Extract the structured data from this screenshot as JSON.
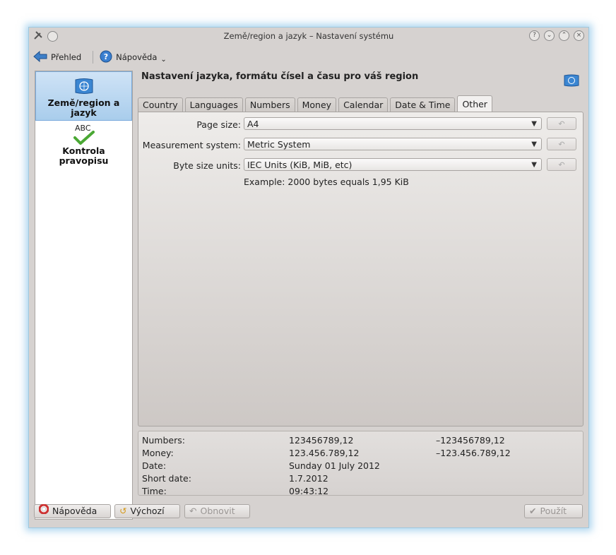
{
  "window": {
    "title": "Země/region a jazyk – Nastavení systému"
  },
  "toolbar": {
    "overview_label": "Přehled",
    "help_label": "Nápověda"
  },
  "sidebar": {
    "items": [
      {
        "label_line1": "Země/region a",
        "label_line2": "jazyk"
      },
      {
        "label_line1": "Kontrola",
        "label_line2": "pravopisu",
        "icon_text": "ABC"
      }
    ]
  },
  "content": {
    "title": "Nastavení jazyka, formátu čísel a času pro váš region"
  },
  "tabs": [
    "Country",
    "Languages",
    "Numbers",
    "Money",
    "Calendar",
    "Date & Time",
    "Other"
  ],
  "active_tab": "Other",
  "settings": {
    "page_size": {
      "label": "Page size:",
      "value": "A4"
    },
    "measurement": {
      "label": "Measurement system:",
      "value": "Metric System"
    },
    "byte_units": {
      "label": "Byte size units:",
      "value": "IEC Units (KiB, MiB, etc)"
    },
    "example": "Example: 2000 bytes equals 1,95 KiB"
  },
  "preview": {
    "rows": [
      {
        "label": "Numbers:",
        "v1": "123456789,12",
        "v2": "–123456789,12"
      },
      {
        "label": "Money:",
        "v1": "123.456.789,12",
        "v2": "–123.456.789,12"
      },
      {
        "label": "Date:",
        "v1": "Sunday 01 July 2012",
        "v2": ""
      },
      {
        "label": "Short date:",
        "v1": "1.7.2012",
        "v2": ""
      },
      {
        "label": "Time:",
        "v1": "09:43:12",
        "v2": ""
      }
    ]
  },
  "buttons": {
    "help": "Nápověda",
    "defaults": "Výchozí",
    "reset": "Obnovit",
    "apply": "Použít"
  },
  "colors": {
    "window_bg": "#d6d2d0",
    "selection": "#a9cdec",
    "glow": "#6eb4e1"
  }
}
